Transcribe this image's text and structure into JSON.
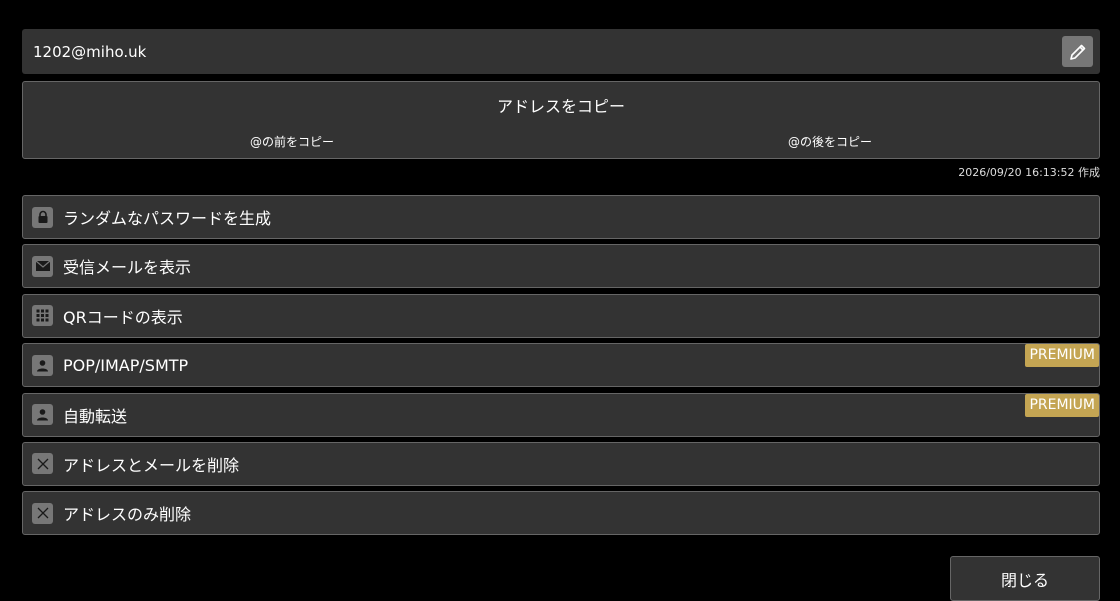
{
  "address": {
    "value": "1202@miho.uk",
    "edit_icon": "pencil-icon"
  },
  "copy": {
    "main_label": "アドレスをコピー",
    "before_label": "@の前をコピー",
    "after_label": "@の後をコピー"
  },
  "created": "2026/09/20 16:13:52 作成",
  "menu": {
    "items": [
      {
        "icon": "lock-icon",
        "label": "ランダムなパスワードを生成"
      },
      {
        "icon": "envelope-icon",
        "label": "受信メールを表示"
      },
      {
        "icon": "grid-icon",
        "label": "QRコードの表示"
      },
      {
        "icon": "user-icon",
        "label": "POP/IMAP/SMTP",
        "badge": "PREMIUM"
      },
      {
        "icon": "user-icon",
        "label": "自動転送",
        "badge": "PREMIUM"
      },
      {
        "icon": "close-icon",
        "label": "アドレスとメールを削除"
      },
      {
        "icon": "close-icon",
        "label": "アドレスのみ削除"
      }
    ]
  },
  "close_label": "閉じる",
  "colors": {
    "background": "#000000",
    "panel": "#333333",
    "border": "#666666",
    "icon_bg": "#777777",
    "premium_badge": "#c4a553"
  }
}
